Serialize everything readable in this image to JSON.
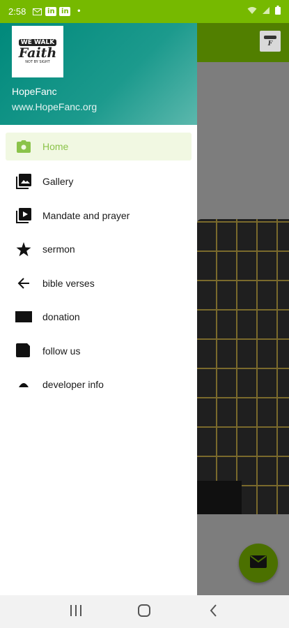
{
  "status_bar": {
    "time": "2:58",
    "icons": [
      "mail-icon",
      "linkedin-icon",
      "linkedin-icon",
      "dot"
    ],
    "right_icons": [
      "wifi-icon",
      "signal-icon",
      "battery-icon"
    ]
  },
  "drawer": {
    "header": {
      "logo": {
        "line1": "WE WALK",
        "line2": "Faith",
        "line3": "NOT BY SIGHT"
      },
      "name": "HopeFanc",
      "url": "www.HopeFanc.org"
    },
    "items": [
      {
        "label": "Home",
        "icon": "camera-icon",
        "active": true
      },
      {
        "label": "Gallery",
        "icon": "gallery-icon",
        "active": false
      },
      {
        "label": "Mandate and prayer",
        "icon": "video-library-icon",
        "active": false
      },
      {
        "label": "sermon",
        "icon": "star-icon",
        "active": false
      },
      {
        "label": "bible verses",
        "icon": "arrow-back-icon",
        "active": false
      },
      {
        "label": "donation",
        "icon": "card-icon",
        "active": false
      },
      {
        "label": "follow us",
        "icon": "follow-icon",
        "active": false
      },
      {
        "label": "developer info",
        "icon": "person-icon",
        "active": false
      }
    ]
  },
  "colors": {
    "status_bar": "#76b900",
    "header_gradient_start": "#00897b",
    "active_label": "#8bc34a",
    "fab": "#4b7000"
  },
  "fab": {
    "icon": "mail-icon"
  },
  "navbar": {
    "buttons": [
      "recents-icon",
      "home-icon",
      "back-icon"
    ]
  }
}
